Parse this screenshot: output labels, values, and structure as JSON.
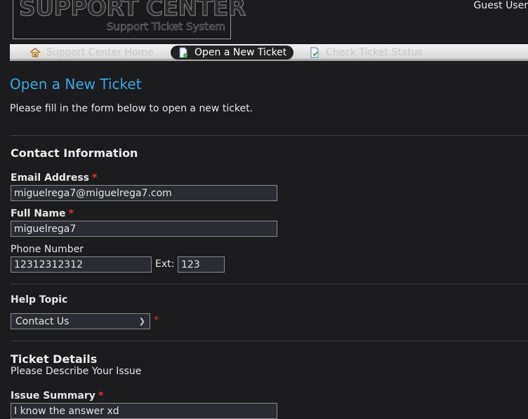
{
  "header": {
    "logo_title": "SUPPORT CENTER",
    "logo_subtitle": "Support Ticket System",
    "user": "Guest User"
  },
  "nav": {
    "home": "Support Center Home",
    "new_ticket": "Open a New Ticket",
    "check_status": "Check Ticket Status"
  },
  "page": {
    "title": "Open a New Ticket",
    "intro": "Please fill in the form below to open a new ticket."
  },
  "contact": {
    "heading": "Contact Information",
    "email_label": "Email Address",
    "email_value": "miguelrega7@miguelrega7.com",
    "name_label": "Full Name",
    "name_value": "miguelrega7",
    "phone_label": "Phone Number",
    "phone_value": "12312312312",
    "ext_label": "Ext:",
    "ext_value": "123",
    "required_mark": "*"
  },
  "help": {
    "label": "Help Topic",
    "selected": "Contact Us",
    "required_mark": "*"
  },
  "details": {
    "heading": "Ticket Details",
    "subheading": "Please Describe Your Issue",
    "summary_label": "Issue Summary",
    "summary_value": "I know the answer xd",
    "required_mark": "*"
  },
  "colors": {
    "background": "#1c1c1f",
    "title_blue": "#3aa8e0",
    "required_red": "#e0342e"
  }
}
